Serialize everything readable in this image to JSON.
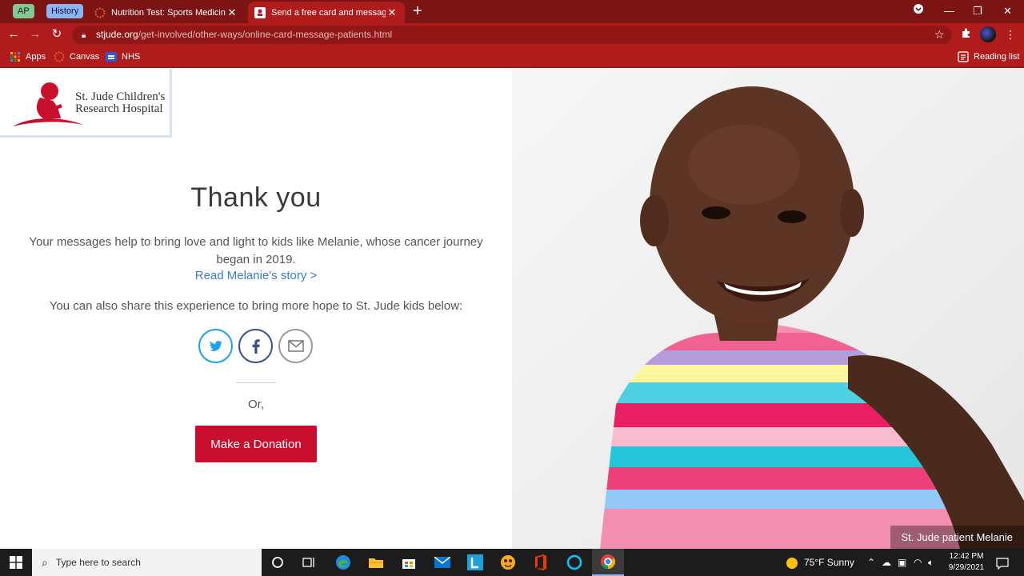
{
  "browser": {
    "tab_groups": [
      {
        "label": "AP",
        "color": "#81c995"
      },
      {
        "label": "History",
        "color": "#8ab4f8"
      }
    ],
    "tabs": [
      {
        "title": "Nutrition Test: Sports Medicine II"
      },
      {
        "title": "Send a free card and message to patients"
      }
    ],
    "url_host": "stjude.org",
    "url_path": "/get-involved/other-ways/online-card-message-patients.html",
    "bookmarks": [
      {
        "label": "Apps"
      },
      {
        "label": "Canvas"
      },
      {
        "label": "NHS"
      }
    ],
    "reading_list": "Reading list",
    "theme_color": "#b01c1c"
  },
  "page": {
    "logo": {
      "line1": "St. Jude Children's",
      "line2": "Research Hospital"
    },
    "title": "Thank you",
    "message": "Your messages help to bring love and light to kids like Melanie, whose cancer journey began in 2019.",
    "story_link": "Read Melanie's story >",
    "share_text": "You can also share this experience to bring more hope to St. Jude kids below:",
    "or_text": "Or,",
    "donate_label": "Make a Donation",
    "donate_color": "#c8102e",
    "caption": "St. Jude patient Melanie"
  },
  "taskbar": {
    "search_placeholder": "Type here to search",
    "weather": "75°F  Sunny",
    "time": "12:42 PM",
    "date": "9/29/2021"
  }
}
